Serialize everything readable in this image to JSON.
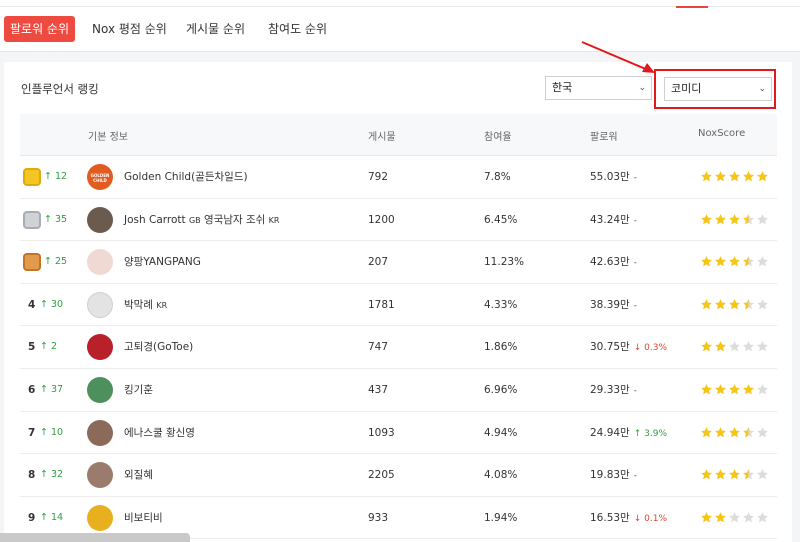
{
  "tabs": [
    {
      "label": "팔로워 순위",
      "active": true
    },
    {
      "label": "Nox 평점 순위",
      "active": false
    },
    {
      "label": "게시물 순위",
      "active": false
    },
    {
      "label": "참여도 순위",
      "active": false
    }
  ],
  "panel": {
    "title": "인플루언서 랭킹",
    "country_select": "한국",
    "category_select": "코미디"
  },
  "columns": [
    "기본 정보",
    "게시물",
    "참여율",
    "팔로워",
    "NoxScore"
  ],
  "rows": [
    {
      "rank": "1",
      "change": "12",
      "name": "Golden Child(골든차일드)",
      "country": "",
      "posts": "792",
      "engagement": "7.8%",
      "followers": "55.03만",
      "delta": "-",
      "delta_dir": "none",
      "score": 5
    },
    {
      "rank": "2",
      "change": "35",
      "name": "Josh Carrott",
      "country": "GB",
      "name_suffix": "영국남자 조쉬",
      "country2": "KR",
      "posts": "1200",
      "engagement": "6.45%",
      "followers": "43.24만",
      "delta": "-",
      "delta_dir": "none",
      "score": 3.5
    },
    {
      "rank": "3",
      "change": "25",
      "name": "양팡YANGPANG",
      "country": "",
      "posts": "207",
      "engagement": "11.23%",
      "followers": "42.63만",
      "delta": "-",
      "delta_dir": "none",
      "score": 3.5
    },
    {
      "rank": "4",
      "change": "30",
      "name": "박막례",
      "country": "KR",
      "posts": "1781",
      "engagement": "4.33%",
      "followers": "38.39만",
      "delta": "-",
      "delta_dir": "none",
      "score": 3.5
    },
    {
      "rank": "5",
      "change": "2",
      "name": "고퇴경(GoToe)",
      "country": "",
      "posts": "747",
      "engagement": "1.86%",
      "followers": "30.75만",
      "delta": "0.3%",
      "delta_dir": "down",
      "score": 2
    },
    {
      "rank": "6",
      "change": "37",
      "name": "킹기훈",
      "country": "",
      "posts": "437",
      "engagement": "6.96%",
      "followers": "29.33만",
      "delta": "-",
      "delta_dir": "none",
      "score": 4
    },
    {
      "rank": "7",
      "change": "10",
      "name": "에나스쿨 황신영",
      "country": "",
      "posts": "1093",
      "engagement": "4.94%",
      "followers": "24.94만",
      "delta": "3.9%",
      "delta_dir": "up",
      "score": 3.5
    },
    {
      "rank": "8",
      "change": "32",
      "name": "외질혜",
      "country": "",
      "posts": "2205",
      "engagement": "4.08%",
      "followers": "19.83만",
      "delta": "-",
      "delta_dir": "none",
      "score": 3.5
    },
    {
      "rank": "9",
      "change": "14",
      "name": "비보티비",
      "country": "",
      "posts": "933",
      "engagement": "1.94%",
      "followers": "16.53만",
      "delta": "0.1%",
      "delta_dir": "down",
      "score": 2
    }
  ],
  "avatar_labels": {
    "golden_child": "GOLDEN CHILD"
  },
  "colors": {
    "accent": "#ee4a3f",
    "star": "#f5c518",
    "star_empty": "#dcdcdc",
    "up": "#2e9e43",
    "down": "#e0452f",
    "highlight_box": "#e0191c"
  }
}
